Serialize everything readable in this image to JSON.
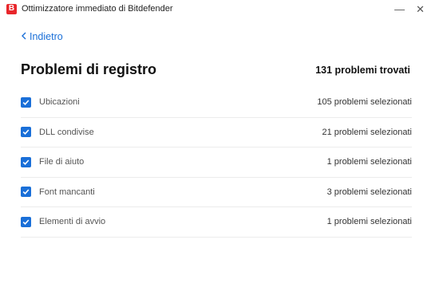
{
  "window": {
    "logo_letter": "B",
    "title": "Ottimizzatore immediato di Bitdefender",
    "minimize_glyph": "—",
    "close_glyph": "✕"
  },
  "nav": {
    "back_label": "Indietro"
  },
  "header": {
    "title": "Problemi di registro",
    "found": "131 problemi trovati"
  },
  "items": [
    {
      "label": "Ubicazioni",
      "count": "105 problemi selezionati",
      "checked": true
    },
    {
      "label": "DLL condivise",
      "count": "21 problemi selezionati",
      "checked": true
    },
    {
      "label": "File di aiuto",
      "count": "1 problemi selezionati",
      "checked": true
    },
    {
      "label": "Font mancanti",
      "count": "3 problemi selezionati",
      "checked": true
    },
    {
      "label": "Elementi di avvio",
      "count": "1 problemi selezionati",
      "checked": true
    }
  ],
  "colors": {
    "accent": "#1a6fd8",
    "logo_red": "#e8262b"
  }
}
